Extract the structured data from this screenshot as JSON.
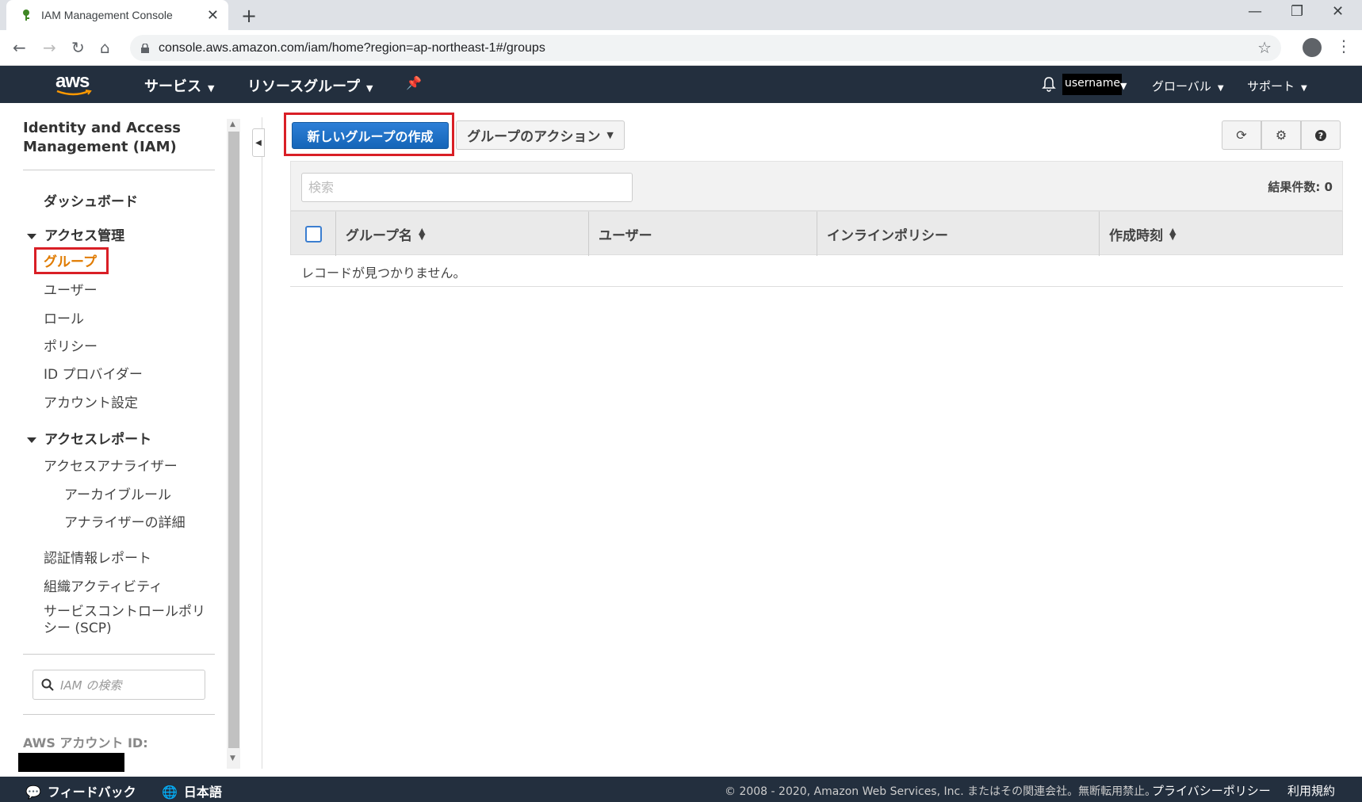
{
  "browser": {
    "tab_title": "IAM Management Console",
    "url": "console.aws.amazon.com/iam/home?region=ap-northeast-1#/groups"
  },
  "aws_nav": {
    "logo": "aws",
    "services": "サービス",
    "resource_groups": "リソースグループ",
    "username": "username",
    "region": "グローバル",
    "support": "サポート"
  },
  "sidebar": {
    "title": "Identity and Access Management (IAM)",
    "dashboard": "ダッシュボード",
    "access_management": "アクセス管理",
    "groups": "グループ",
    "users": "ユーザー",
    "roles": "ロール",
    "policies": "ポリシー",
    "id_providers": "ID プロバイダー",
    "account_settings": "アカウント設定",
    "access_reports": "アクセスレポート",
    "access_analyzer": "アクセスアナライザー",
    "archive_rules": "アーカイブルール",
    "analyzer_details": "アナライザーの詳細",
    "credential_report": "認証情報レポート",
    "org_activity": "組織アクティビティ",
    "scp": "サービスコントロールポリシー (SCP)",
    "search_placeholder": "IAM の検索",
    "account_id_label": "AWS アカウント ID:"
  },
  "main": {
    "create_group_button": "新しいグループの作成",
    "group_actions_button": "グループのアクション",
    "search_placeholder": "検索",
    "result_count": "結果件数: 0",
    "columns": [
      "グループ名",
      "ユーザー",
      "インラインポリシー",
      "作成時刻"
    ],
    "no_records": "レコードが見つかりません。"
  },
  "footer": {
    "feedback": "フィードバック",
    "language": "日本語",
    "copyright": "© 2008 - 2020, Amazon Web Services, Inc. またはその関連会社。無断転用禁止。",
    "privacy": "プライバシーポリシー",
    "terms": "利用規約"
  }
}
